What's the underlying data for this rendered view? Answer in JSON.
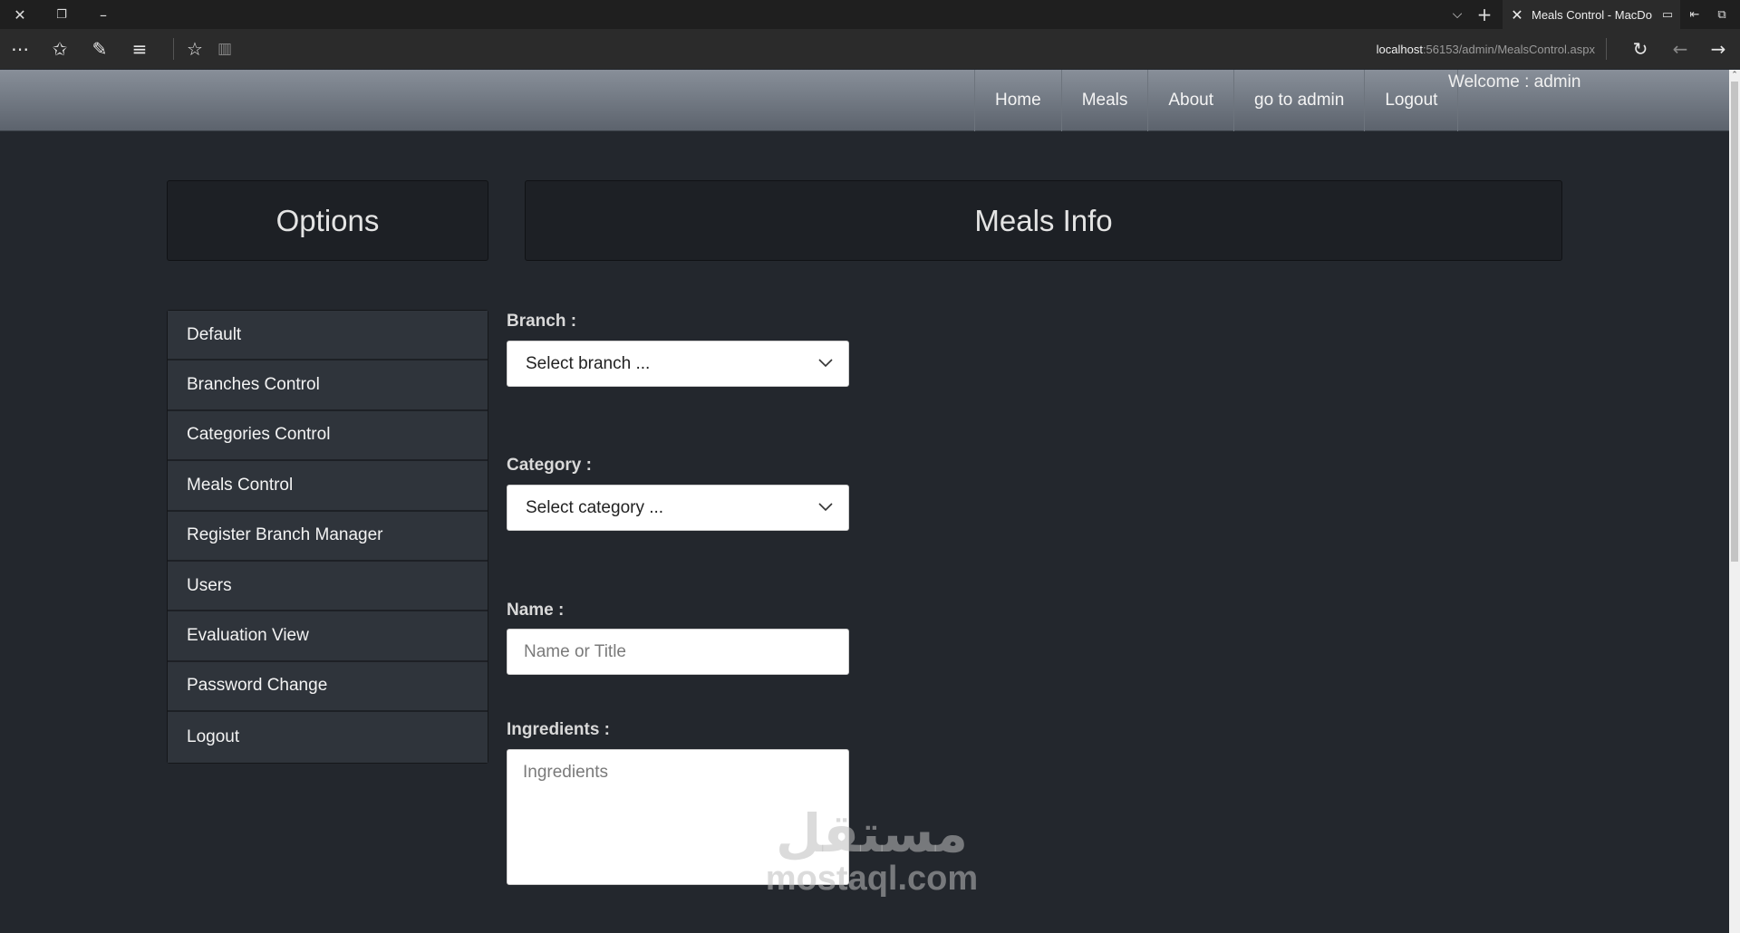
{
  "browser": {
    "tab_title": "Meals Control - MacDo",
    "address_host": "localhost",
    "address_path": ":56153/admin/MealsControl.aspx",
    "icons": [
      "close-icon",
      "restore-icon",
      "minimize-icon",
      "tab-list-icon",
      "new-tab-icon",
      "more-icon",
      "hub-icon",
      "pen-icon",
      "reading-list-icon",
      "favorite-icon",
      "reading-view-icon",
      "refresh-icon",
      "back-icon",
      "forward-icon"
    ]
  },
  "nav": {
    "links": [
      "Home",
      "Meals",
      "About",
      "go to admin",
      "Logout"
    ],
    "welcome": "Welcome : admin"
  },
  "options_title": "Options",
  "main_title": "Meals Info",
  "menu": [
    "Default",
    "Branches Control",
    "Categories Control",
    "Meals Control",
    "Register Branch Manager",
    "Users",
    "Evaluation View",
    "Password Change",
    "Logout"
  ],
  "form": {
    "branch_label": "Branch :",
    "branch_selected": "Select branch ...",
    "category_label": "Category :",
    "category_selected": "Select category ...",
    "name_label": "Name :",
    "name_placeholder": "Name or Title",
    "ingredients_label": "Ingredients :",
    "ingredients_placeholder": "Ingredients"
  },
  "watermark": {
    "arabic": "مستقل",
    "latin": "mostaql.com"
  },
  "colors": {
    "page_bg": "#23272d",
    "panel_bg": "#1d2025",
    "menu_item_bg": "#2f343b"
  }
}
